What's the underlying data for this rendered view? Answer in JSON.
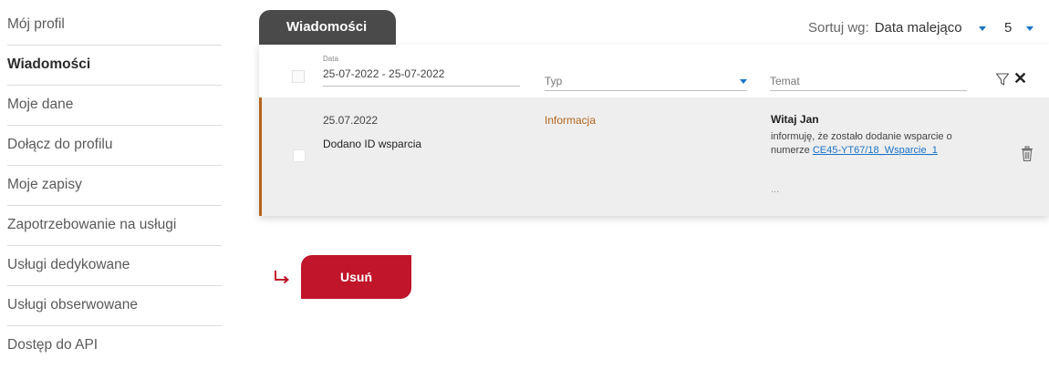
{
  "sidebar": {
    "items": [
      {
        "label": "Mój profil",
        "active": false
      },
      {
        "label": "Wiadomości",
        "active": true
      },
      {
        "label": "Moje dane",
        "active": false
      },
      {
        "label": "Dołącz do profilu",
        "active": false
      },
      {
        "label": "Moje zapisy",
        "active": false
      },
      {
        "label": "Zapotrzebowanie na usługi",
        "active": false
      },
      {
        "label": "Usługi dedykowane",
        "active": false
      },
      {
        "label": "Usługi obserwowane",
        "active": false
      },
      {
        "label": "Dostęp do API",
        "active": false
      }
    ]
  },
  "tab": {
    "label": "Wiadomości"
  },
  "sort": {
    "label": "Sortuj wg:",
    "value": "Data malejąco",
    "page_size": "5"
  },
  "filters": {
    "date_label": "Data",
    "date_value": "25-07-2022 - 25-07-2022",
    "type_placeholder": "Typ",
    "subject_placeholder": "Temat"
  },
  "message": {
    "date": "25.07.2022",
    "title": "Dodano ID wsparcia",
    "type": "Informacja",
    "subject": "Witaj Jan",
    "body_text": "informuję, że zostało dodanie wsparcie o numerze",
    "body_link": "CE45-YT67/18_Wsparcie_1",
    "ellipsis": "..."
  },
  "actions": {
    "delete_label": "Usuń"
  },
  "colors": {
    "accent": "#c0152a",
    "tab_bg": "#4a4a4a",
    "type_color": "#b5651d",
    "link": "#1a73c8"
  },
  "icons": [
    "funnel-icon",
    "close-icon",
    "trash-icon",
    "return-arrow-icon",
    "chevron-down-icon"
  ]
}
